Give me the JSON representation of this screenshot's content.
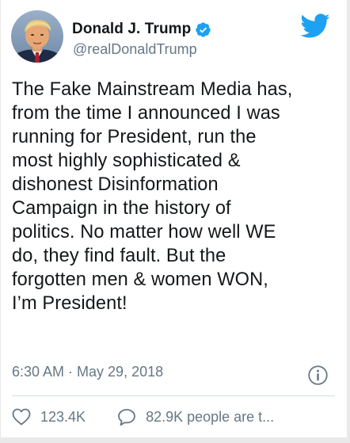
{
  "author": {
    "display_name": "Donald J. Trump",
    "handle": "@realDonaldTrump",
    "verified": true
  },
  "tweet": {
    "text": "The Fake Mainstream Media has,\nfrom the time I announced I was\nrunning for President, run the\nmost highly sophisticated &\ndishonest Disinformation\nCampaign in the history of\npolitics. No matter how well WE\ndo, they find fault. But the\nforgotten men & women WON,\nI’m President!",
    "timestamp": "6:30 AM · May 29, 2018"
  },
  "actions": {
    "like_count": "123.4K",
    "reply_label": "82.9K people are t..."
  },
  "icons": {
    "verified": "verified-badge-icon",
    "brand": "twitter-bird-icon",
    "info": "info-icon",
    "like": "heart-icon",
    "reply": "speech-bubble-icon"
  },
  "colors": {
    "brand": "#1da1f2",
    "text": "#14171a",
    "secondary": "#657786"
  }
}
